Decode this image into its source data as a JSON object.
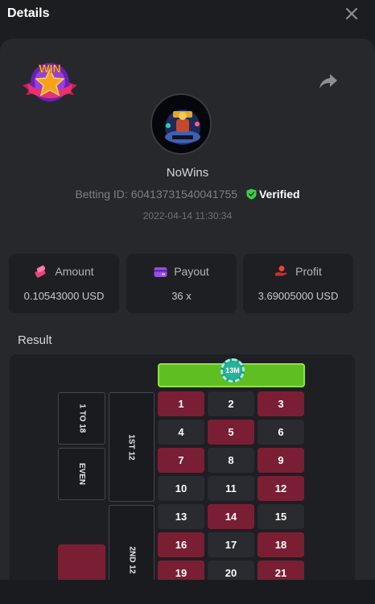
{
  "header": {
    "title": "Details"
  },
  "user": {
    "name": "NoWins",
    "betting_id_label": "Betting ID:",
    "betting_id": "60413731540041755",
    "verified_label": "Verified",
    "timestamp": "2022-04-14 11:30:34"
  },
  "badge": {
    "text": "WIN"
  },
  "stats": {
    "amount": {
      "label": "Amount",
      "value": "0.10543000 USD"
    },
    "payout": {
      "label": "Payout",
      "value": "36 x"
    },
    "profit": {
      "label": "Profit",
      "value": "3.69005000 USD"
    }
  },
  "result": {
    "label": "Result",
    "chip": "13M",
    "side": {
      "low": "1 TO 18",
      "even": "EVEN",
      "dozen1": "1ST 12",
      "dozen2": "2ND 12"
    },
    "numbers": [
      {
        "n": "1",
        "color": "red"
      },
      {
        "n": "2",
        "color": "black"
      },
      {
        "n": "3",
        "color": "red"
      },
      {
        "n": "4",
        "color": "black"
      },
      {
        "n": "5",
        "color": "red"
      },
      {
        "n": "6",
        "color": "black"
      },
      {
        "n": "7",
        "color": "red"
      },
      {
        "n": "8",
        "color": "black"
      },
      {
        "n": "9",
        "color": "red"
      },
      {
        "n": "10",
        "color": "black"
      },
      {
        "n": "11",
        "color": "black"
      },
      {
        "n": "12",
        "color": "red"
      },
      {
        "n": "13",
        "color": "black"
      },
      {
        "n": "14",
        "color": "red"
      },
      {
        "n": "15",
        "color": "black"
      },
      {
        "n": "16",
        "color": "red"
      },
      {
        "n": "17",
        "color": "black"
      },
      {
        "n": "18",
        "color": "red"
      },
      {
        "n": "19",
        "color": "red"
      },
      {
        "n": "20",
        "color": "black"
      },
      {
        "n": "21",
        "color": "red"
      }
    ]
  },
  "colors": {
    "green": "#5fbf22",
    "red": "#7a1f33",
    "black": "#2a2b30",
    "verified": "#3ccf4e"
  }
}
